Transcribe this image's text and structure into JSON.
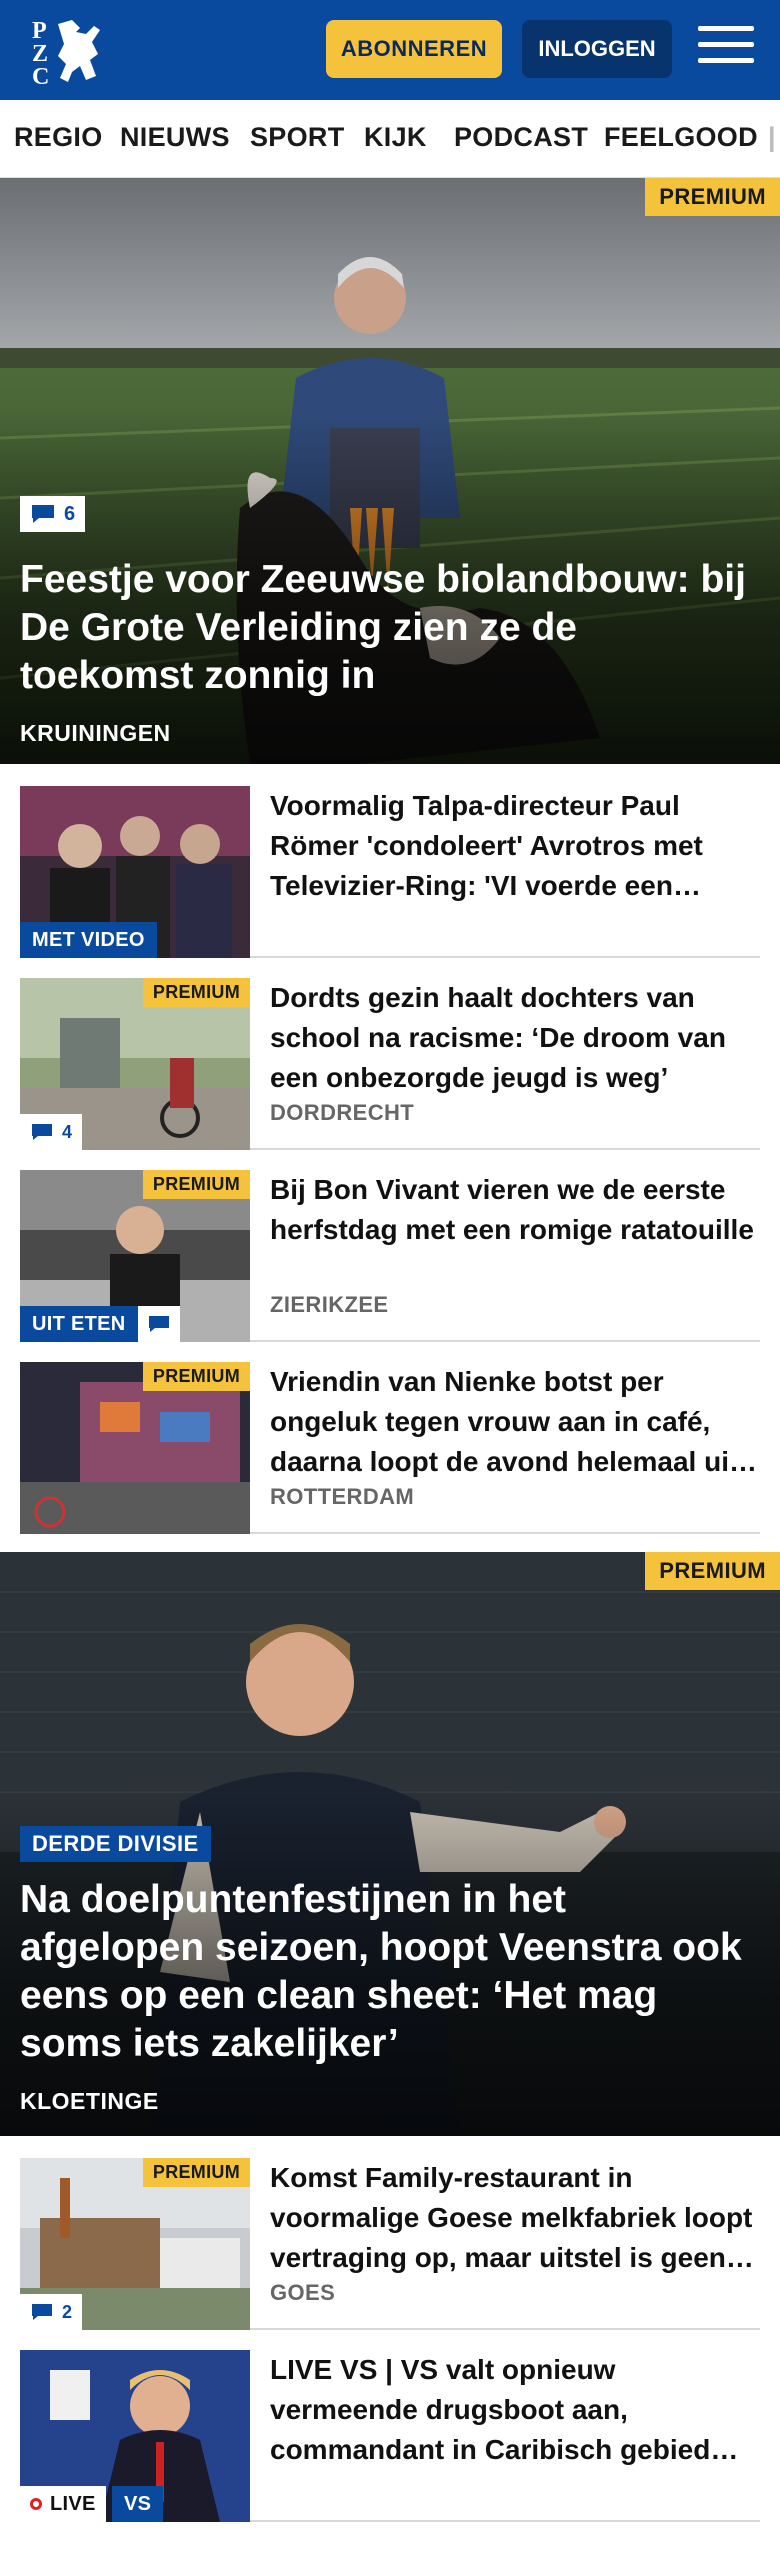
{
  "header": {
    "logo_letters": [
      "P",
      "Z",
      "C"
    ],
    "subscribe_label": "ABONNEREN",
    "login_label": "INLOGGEN"
  },
  "nav": {
    "items": [
      "REGIO",
      "NIEUWS",
      "SPORT",
      "KIJK",
      "PODCAST",
      "FEELGOOD"
    ]
  },
  "hero1": {
    "premium": "PREMIUM",
    "comments": "6",
    "title": "Feestje voor Zeeuwse biolandbouw: bij De Grote Verleiding zien ze de toekomst zonnig in",
    "location": "KRUININGEN"
  },
  "list1": [
    {
      "title": "Voormalig Talpa-directeur Paul Römer 'condoleert' Avrotros met Televizier-Ring: 'VI voerde een campagne'",
      "label": "MET VIDEO"
    },
    {
      "title": "Dordts gezin haalt dochters van school na racisme: ‘De droom van een onbezorgde jeugd is weg’",
      "location": "DORDRECHT",
      "premium": "PREMIUM",
      "comments": "4"
    },
    {
      "title": "Bij Bon Vivant vieren we de eerste herfstdag met een romige ratatouille",
      "location": "ZIERIKZEE",
      "premium": "PREMIUM",
      "label": "UIT ETEN"
    },
    {
      "title": "Vriendin van Nienke botst per ongeluk tegen vrouw aan in café, daarna loopt de avond helemaal uit de hand",
      "location": "ROTTERDAM",
      "premium": "PREMIUM"
    }
  ],
  "hero2": {
    "premium": "PREMIUM",
    "label": "DERDE DIVISIE",
    "title": "Na doelpuntenfestijnen in het afgelopen seizoen, hoopt Veenstra ook eens op een clean sheet: ‘Het mag soms iets zakelijker’",
    "location": "KLOETINGE"
  },
  "list2": [
    {
      "title": "Komst Family-restaurant in voormalige Goese melkfabriek loopt vertraging op, maar uitstel is geen afstel",
      "location": "GOES",
      "premium": "PREMIUM",
      "comments": "2"
    },
    {
      "title": "LIVE VS | VS valt opnieuw vermeende drugsboot aan, commandant in Caribisch gebied stapt op",
      "live_label": "LIVE",
      "region_label": "VS"
    }
  ],
  "colors": {
    "brand_blue": "#0a4a9e",
    "premium_yellow": "#f5c33b"
  }
}
